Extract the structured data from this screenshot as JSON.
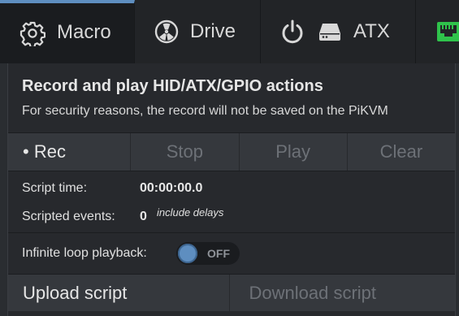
{
  "menu": {
    "macro": {
      "label": "Macro",
      "icon": "gear-icon"
    },
    "drive": {
      "label": "Drive",
      "icon": "fan-icon"
    },
    "atx": {
      "label": "ATX",
      "icon": "power-icon",
      "icon2": "server-icon"
    },
    "gpio": {
      "icon": "ethernet-port-icon",
      "color": "#2fc24b"
    }
  },
  "panel": {
    "title": "Record and play HID/ATX/GPIO actions",
    "subtitle": "For security reasons, the record will not be saved on the PiKVM",
    "actions": {
      "rec": "• Rec",
      "stop": "Stop",
      "play": "Play",
      "clear": "Clear"
    },
    "script_time_label": "Script time:",
    "script_time_value": "00:00:00.0",
    "scripted_events_label": "Scripted events:",
    "scripted_events_value": "0",
    "include_delays_note": "include delays",
    "infinite_loop_label": "Infinite loop playback:",
    "infinite_loop_state": "OFF",
    "upload_label": "Upload script",
    "download_label": "Download script"
  },
  "colors": {
    "accent": "#5e8ec0",
    "background": "#2a2d31",
    "disabled_text": "#6d7177"
  }
}
